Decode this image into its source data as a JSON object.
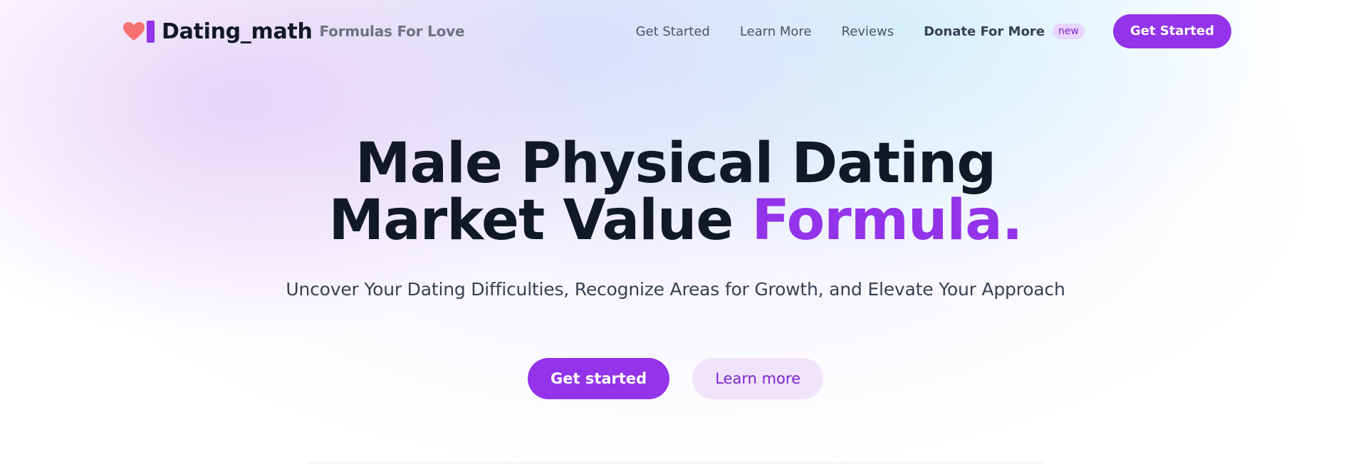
{
  "brand": {
    "name": "Dating_math",
    "tagline": "Formulas For Love",
    "heart_icon": "heart-icon",
    "heart_color": "#f87171",
    "bar_color": "#9333ea"
  },
  "nav": {
    "items": [
      {
        "label": "Get Started"
      },
      {
        "label": "Learn More"
      },
      {
        "label": "Reviews"
      }
    ],
    "donate": {
      "label": "Donate For More",
      "badge": "new"
    },
    "cta": "Get Started"
  },
  "hero": {
    "title_line1": "Male Physical Dating",
    "title_line2": "Market Value",
    "title_accent": "Formula.",
    "subtitle": "Uncover Your Dating Difficulties, Recognize Areas for Growth, and Elevate Your Approach",
    "primary_button": "Get started",
    "secondary_button": "Learn more"
  },
  "colors": {
    "accent": "#9333ea",
    "text_dark": "#111827",
    "text_muted": "#6b7280"
  }
}
